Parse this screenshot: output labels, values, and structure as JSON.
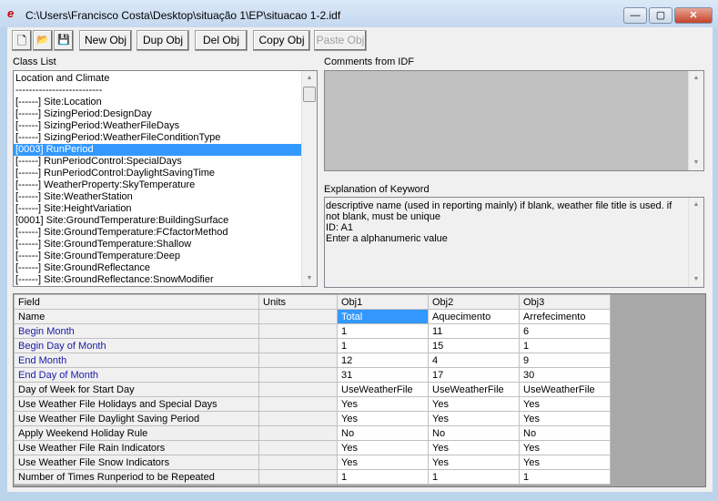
{
  "window": {
    "title": "C:\\Users\\Francisco Costa\\Desktop\\situação 1\\EP\\situacao 1-2.idf",
    "minimize": "—",
    "maximize": "▢",
    "close": "✕"
  },
  "toolbar": {
    "new_file": "🗋",
    "open": "📂",
    "save": "💾",
    "new_obj": "New Obj",
    "dup_obj": "Dup Obj",
    "del_obj": "Del Obj",
    "copy_obj": "Copy Obj",
    "paste_obj": "Paste Obj"
  },
  "class_list": {
    "label": "Class List",
    "items": [
      {
        "text": "Location and Climate"
      },
      {
        "text": "--------------------------"
      },
      {
        "text": "[------]  Site:Location"
      },
      {
        "text": "[------]  SizingPeriod:DesignDay"
      },
      {
        "text": "[------]  SizingPeriod:WeatherFileDays"
      },
      {
        "text": "[------]  SizingPeriod:WeatherFileConditionType"
      },
      {
        "text": "[0003]  RunPeriod",
        "selected": true
      },
      {
        "text": "[------]  RunPeriodControl:SpecialDays"
      },
      {
        "text": "[------]  RunPeriodControl:DaylightSavingTime"
      },
      {
        "text": "[------]  WeatherProperty:SkyTemperature"
      },
      {
        "text": "[------]  Site:WeatherStation"
      },
      {
        "text": "[------]  Site:HeightVariation"
      },
      {
        "text": "[0001]  Site:GroundTemperature:BuildingSurface"
      },
      {
        "text": "[------]  Site:GroundTemperature:FCfactorMethod"
      },
      {
        "text": "[------]  Site:GroundTemperature:Shallow"
      },
      {
        "text": "[------]  Site:GroundTemperature:Deep"
      },
      {
        "text": "[------]  Site:GroundReflectance"
      },
      {
        "text": "[------]  Site:GroundReflectance:SnowModifier"
      }
    ]
  },
  "comments": {
    "label": "Comments from IDF",
    "text": ""
  },
  "explanation": {
    "label": "Explanation of Keyword",
    "lines": [
      " descriptive name (used in reporting mainly) if blank, weather file title is used.  if not blank, must be unique",
      "ID: A1",
      "Enter a alphanumeric value"
    ]
  },
  "grid": {
    "headers": [
      "Field",
      "Units",
      "Obj1",
      "Obj2",
      "Obj3"
    ],
    "rows": [
      {
        "field": "Name",
        "units": "",
        "vals": [
          "Total",
          "Aquecimento",
          "Arrefecimento"
        ]
      },
      {
        "field": "Begin Month",
        "units": "",
        "vals": [
          "1",
          "11",
          "6"
        ],
        "required": true
      },
      {
        "field": "Begin Day of Month",
        "units": "",
        "vals": [
          "1",
          "15",
          "1"
        ],
        "required": true
      },
      {
        "field": "End Month",
        "units": "",
        "vals": [
          "12",
          "4",
          "9"
        ],
        "required": true
      },
      {
        "field": "End Day of Month",
        "units": "",
        "vals": [
          "31",
          "17",
          "30"
        ],
        "required": true
      },
      {
        "field": "Day of Week for Start Day",
        "units": "",
        "vals": [
          "UseWeatherFile",
          "UseWeatherFile",
          "UseWeatherFile"
        ]
      },
      {
        "field": "Use Weather File Holidays and Special Days",
        "units": "",
        "vals": [
          "Yes",
          "Yes",
          "Yes"
        ]
      },
      {
        "field": "Use Weather File Daylight Saving Period",
        "units": "",
        "vals": [
          "Yes",
          "Yes",
          "Yes"
        ]
      },
      {
        "field": "Apply Weekend Holiday Rule",
        "units": "",
        "vals": [
          "No",
          "No",
          "No"
        ]
      },
      {
        "field": "Use Weather File Rain Indicators",
        "units": "",
        "vals": [
          "Yes",
          "Yes",
          "Yes"
        ]
      },
      {
        "field": "Use Weather File Snow Indicators",
        "units": "",
        "vals": [
          "Yes",
          "Yes",
          "Yes"
        ]
      },
      {
        "field": "Number of Times Runperiod to be Repeated",
        "units": "",
        "vals": [
          "1",
          "1",
          "1"
        ]
      }
    ]
  },
  "colors": {
    "selection": "#3399ff",
    "required_field": "#1a1aa6"
  }
}
